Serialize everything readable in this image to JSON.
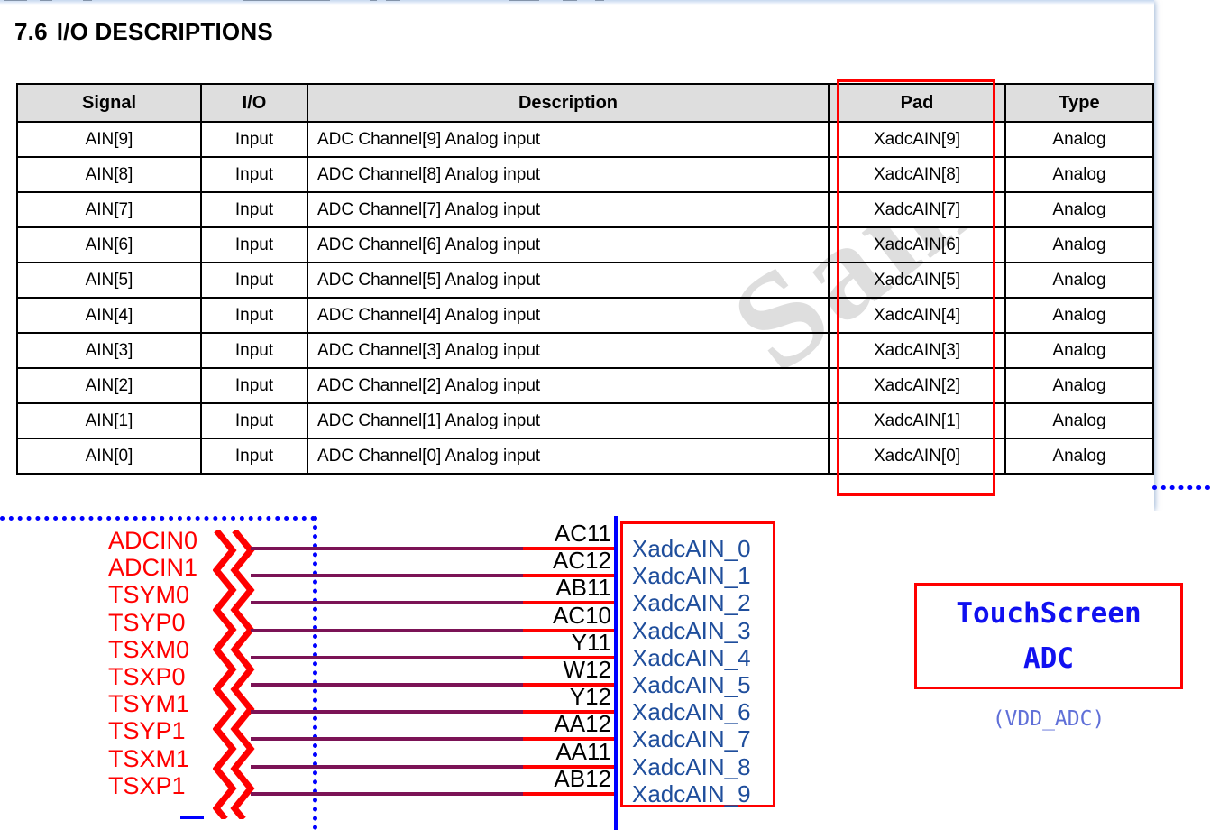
{
  "document": {
    "section_number": "7.6",
    "section_title": "I/O DESCRIPTIONS",
    "watermark_text": "Samsung"
  },
  "table": {
    "headers": [
      "Signal",
      "I/O",
      "Description",
      "Pad",
      "Type"
    ],
    "highlight_color": "#ff0000",
    "highlighted_column": "Pad",
    "rows": [
      {
        "signal": "AIN[9]",
        "io": "Input",
        "description": "ADC Channel[9] Analog input",
        "pad": "XadcAIN[9]",
        "type": "Analog"
      },
      {
        "signal": "AIN[8]",
        "io": "Input",
        "description": "ADC Channel[8] Analog input",
        "pad": "XadcAIN[8]",
        "type": "Analog"
      },
      {
        "signal": "AIN[7]",
        "io": "Input",
        "description": "ADC Channel[7] Analog input",
        "pad": "XadcAIN[7]",
        "type": "Analog"
      },
      {
        "signal": "AIN[6]",
        "io": "Input",
        "description": "ADC Channel[6] Analog input",
        "pad": "XadcAIN[6]",
        "type": "Analog"
      },
      {
        "signal": "AIN[5]",
        "io": "Input",
        "description": "ADC Channel[5] Analog input",
        "pad": "XadcAIN[5]",
        "type": "Analog"
      },
      {
        "signal": "AIN[4]",
        "io": "Input",
        "description": "ADC Channel[4] Analog input",
        "pad": "XadcAIN[4]",
        "type": "Analog"
      },
      {
        "signal": "AIN[3]",
        "io": "Input",
        "description": "ADC Channel[3] Analog input",
        "pad": "XadcAIN[3]",
        "type": "Analog"
      },
      {
        "signal": "AIN[2]",
        "io": "Input",
        "description": "ADC Channel[2] Analog input",
        "pad": "XadcAIN[2]",
        "type": "Analog"
      },
      {
        "signal": "AIN[1]",
        "io": "Input",
        "description": "ADC Channel[1] Analog input",
        "pad": "XadcAIN[1]",
        "type": "Analog"
      },
      {
        "signal": "AIN[0]",
        "io": "Input",
        "description": "ADC Channel[0] Analog input",
        "pad": "XadcAIN[0]",
        "type": "Analog"
      }
    ]
  },
  "schematic": {
    "signal_color": "#ff0000",
    "wire_color": "#7b1356",
    "chip_edge_color": "#0000ff",
    "pad_name_color": "#1f4e9c",
    "nets": [
      {
        "signal": "ADCIN0",
        "ball": "AC11",
        "pad": "XadcAIN_0"
      },
      {
        "signal": "ADCIN1",
        "ball": "AC12",
        "pad": "XadcAIN_1"
      },
      {
        "signal": "TSYM0",
        "ball": "AB11",
        "pad": "XadcAIN_2"
      },
      {
        "signal": "TSYP0",
        "ball": "AC10",
        "pad": "XadcAIN_3"
      },
      {
        "signal": "TSXM0",
        "ball": "Y11",
        "pad": "XadcAIN_4"
      },
      {
        "signal": "TSXP0",
        "ball": "W12",
        "pad": "XadcAIN_5"
      },
      {
        "signal": "TSYM1",
        "ball": "Y12",
        "pad": "XadcAIN_6"
      },
      {
        "signal": "TSYP1",
        "ball": "AA12",
        "pad": "XadcAIN_7"
      },
      {
        "signal": "TSXM1",
        "ball": "AA11",
        "pad": "XadcAIN_8"
      },
      {
        "signal": "TSXP1",
        "ball": "AB12",
        "pad": "XadcAIN_9"
      }
    ],
    "block": {
      "line1": "TouchScreen",
      "line2": "ADC",
      "supply": "(VDD_ADC)",
      "border_color": "#ff0000",
      "text_color": "#1010f0"
    }
  }
}
